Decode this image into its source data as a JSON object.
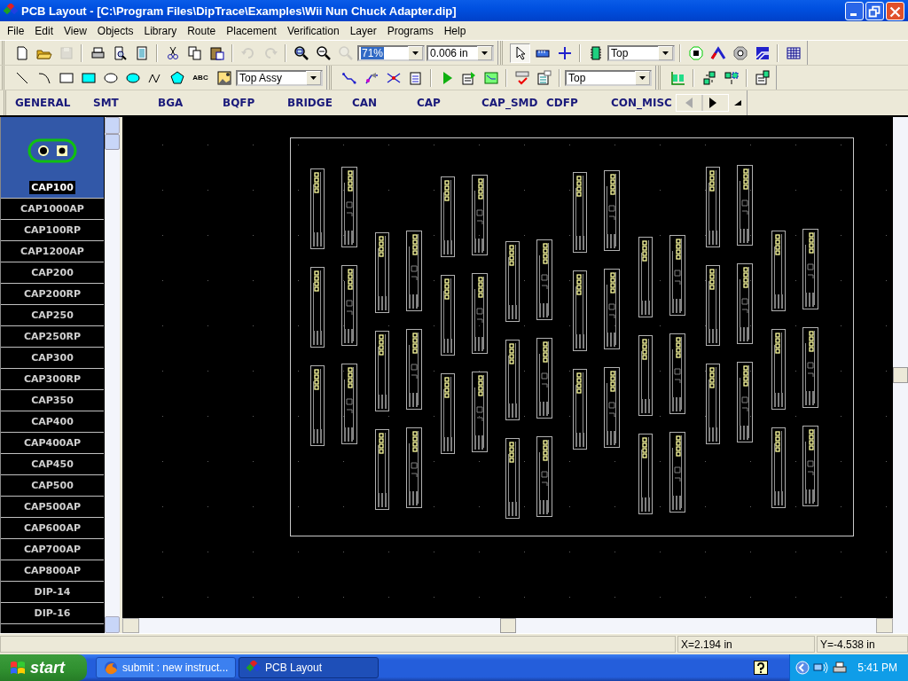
{
  "window": {
    "title": "PCB Layout - [C:\\Program Files\\DipTrace\\Examples\\Wii Nun Chuck Adapter.dip]"
  },
  "menu": [
    "File",
    "Edit",
    "View",
    "Objects",
    "Library",
    "Route",
    "Placement",
    "Verification",
    "Layer",
    "Programs",
    "Help"
  ],
  "toolbars": [
    [
      {
        "kind": "button",
        "disabled": false,
        "selected": false
      },
      {
        "kind": "button",
        "disabled": false,
        "selected": false
      },
      {
        "kind": "button",
        "disabled": true,
        "selected": false
      },
      {
        "kind": "separator"
      },
      {
        "kind": "button",
        "disabled": false,
        "selected": false
      },
      {
        "kind": "button",
        "disabled": false,
        "selected": false
      },
      {
        "kind": "button",
        "disabled": false,
        "selected": false
      },
      {
        "kind": "separator"
      },
      {
        "kind": "button",
        "disabled": false,
        "selected": false
      },
      {
        "kind": "button",
        "disabled": false,
        "selected": false
      },
      {
        "kind": "button",
        "disabled": false,
        "selected": false
      },
      {
        "kind": "separator"
      },
      {
        "kind": "button",
        "disabled": true,
        "selected": false
      },
      {
        "kind": "button",
        "disabled": true,
        "selected": false
      },
      {
        "kind": "separator"
      },
      {
        "kind": "button",
        "disabled": false,
        "selected": false
      },
      {
        "kind": "button",
        "disabled": false,
        "selected": false
      },
      {
        "kind": "button",
        "disabled": true,
        "selected": false
      },
      {
        "kind": "combo",
        "value": "71%",
        "highlighted": true
      },
      {
        "kind": "combo",
        "value": "0.006 in",
        "highlighted": false
      },
      {
        "kind": "grip"
      },
      {
        "kind": "button",
        "disabled": false,
        "selected": true
      },
      {
        "kind": "button",
        "disabled": false,
        "selected": false
      },
      {
        "kind": "button",
        "disabled": false,
        "selected": false
      },
      {
        "kind": "separator"
      },
      {
        "kind": "button",
        "disabled": false,
        "selected": false
      },
      {
        "kind": "combo",
        "value": "Top",
        "highlighted": false
      },
      {
        "kind": "separator"
      },
      {
        "kind": "button",
        "disabled": false,
        "selected": false
      },
      {
        "kind": "button",
        "disabled": false,
        "selected": false
      },
      {
        "kind": "button",
        "disabled": false,
        "selected": false
      },
      {
        "kind": "button",
        "disabled": false,
        "selected": false
      },
      {
        "kind": "separator"
      },
      {
        "kind": "button",
        "disabled": false,
        "selected": false
      }
    ],
    [
      {
        "kind": "button",
        "disabled": false,
        "selected": false
      },
      {
        "kind": "button",
        "disabled": false,
        "selected": false
      },
      {
        "kind": "button",
        "disabled": false,
        "selected": false
      },
      {
        "kind": "button",
        "disabled": false,
        "selected": false
      },
      {
        "kind": "button",
        "disabled": false,
        "selected": false
      },
      {
        "kind": "button",
        "disabled": false,
        "selected": false
      },
      {
        "kind": "button",
        "disabled": false,
        "selected": false
      },
      {
        "kind": "button",
        "disabled": false,
        "selected": false
      },
      {
        "kind": "text_button",
        "label": "ABC"
      },
      {
        "kind": "button",
        "disabled": false,
        "selected": false
      },
      {
        "kind": "combo",
        "value": "Top Assy",
        "highlighted": false
      },
      {
        "kind": "grip"
      },
      {
        "kind": "button",
        "disabled": false,
        "selected": false
      },
      {
        "kind": "button",
        "disabled": false,
        "selected": false
      },
      {
        "kind": "button",
        "disabled": false,
        "selected": false
      },
      {
        "kind": "button",
        "disabled": false,
        "selected": false
      },
      {
        "kind": "separator"
      },
      {
        "kind": "button",
        "disabled": false,
        "selected": false
      },
      {
        "kind": "button",
        "disabled": false,
        "selected": false
      },
      {
        "kind": "button",
        "disabled": false,
        "selected": false
      },
      {
        "kind": "separator"
      },
      {
        "kind": "button",
        "disabled": false,
        "selected": false
      },
      {
        "kind": "button",
        "disabled": false,
        "selected": false
      },
      {
        "kind": "separator"
      },
      {
        "kind": "combo",
        "value": "Top",
        "highlighted": false
      },
      {
        "kind": "grip"
      },
      {
        "kind": "button",
        "disabled": false,
        "selected": false
      },
      {
        "kind": "separator"
      },
      {
        "kind": "button",
        "disabled": false,
        "selected": false
      },
      {
        "kind": "button",
        "disabled": false,
        "selected": false
      },
      {
        "kind": "separator"
      },
      {
        "kind": "button",
        "disabled": false,
        "selected": false
      }
    ]
  ],
  "library_tabs": [
    "GENERAL",
    "SMT",
    "BGA",
    "BQFP",
    "BRIDGE",
    "CAN",
    "CAP",
    "CAP_SMD",
    "CDFP",
    "CON_MISC"
  ],
  "components": [
    {
      "name": "CAP100",
      "selected": true
    },
    {
      "name": "CAP1000AP",
      "selected": false
    },
    {
      "name": "CAP100RP",
      "selected": false
    },
    {
      "name": "CAP1200AP",
      "selected": false
    },
    {
      "name": "CAP200",
      "selected": false
    },
    {
      "name": "CAP200RP",
      "selected": false
    },
    {
      "name": "CAP250",
      "selected": false
    },
    {
      "name": "CAP250RP",
      "selected": false
    },
    {
      "name": "CAP300",
      "selected": false
    },
    {
      "name": "CAP300RP",
      "selected": false
    },
    {
      "name": "CAP350",
      "selected": false
    },
    {
      "name": "CAP400",
      "selected": false
    },
    {
      "name": "CAP400AP",
      "selected": false
    },
    {
      "name": "CAP450",
      "selected": false
    },
    {
      "name": "CAP500",
      "selected": false
    },
    {
      "name": "CAP500AP",
      "selected": false
    },
    {
      "name": "CAP600AP",
      "selected": false
    },
    {
      "name": "CAP700AP",
      "selected": false
    },
    {
      "name": "CAP800AP",
      "selected": false
    },
    {
      "name": "DIP-14",
      "selected": false
    },
    {
      "name": "DIP-16",
      "selected": false
    }
  ],
  "status_bar": {
    "x": "X=2.194 in",
    "y": "Y=-4.538 in"
  },
  "taskbar": {
    "start": "start",
    "tasks": [
      {
        "label": "submit : new instruct...",
        "selected": false
      },
      {
        "label": "PCB Layout",
        "selected": true
      }
    ],
    "time": "5:41 PM"
  }
}
